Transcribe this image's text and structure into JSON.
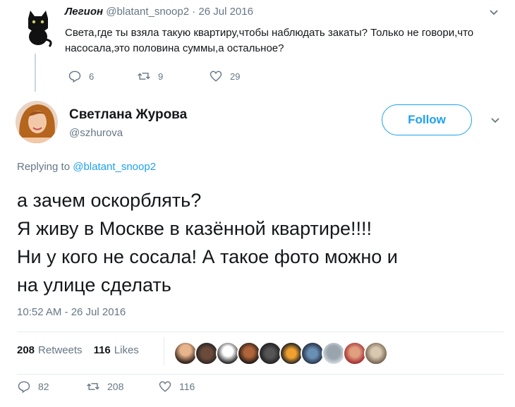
{
  "reply": {
    "name": "Легион",
    "handle": "@blatant_snoop2",
    "date": "· 26 Jul 2016",
    "text": "Света,где ты взяла такую квартиру,чтобы наблюдать закаты? Только не говори,что насосала,это половина суммы,а остальное?",
    "replies": "6",
    "retweets": "9",
    "likes": "29"
  },
  "tweet": {
    "name": "Светлана Журова",
    "handle": "@szhurova",
    "follow_label": "Follow",
    "replying_prefix": "Replying to",
    "replying_to": "@blatant_snoop2",
    "text_lines": [
      "а зачем оскорблять?",
      "Я живу в Москве в казённой квартире!!!!",
      "Ни у кого не сосала! А такое фото можно и",
      "на улице сделать"
    ],
    "timestamp": "10:52 AM - 26 Jul 2016",
    "retweets_count": "208",
    "retweets_label": "Retweets",
    "likes_count": "116",
    "likes_label": "Likes",
    "replies": "82",
    "retweets": "208",
    "likes": "116"
  },
  "colors": {
    "accent": "#1da1f2",
    "muted": "#657786",
    "divider": "#e6ecf0"
  },
  "icons": [
    "cat-avatar",
    "reply-icon",
    "retweet-icon",
    "heart-icon",
    "chevron-down-icon",
    "profile-avatar",
    "liker-avatar"
  ]
}
